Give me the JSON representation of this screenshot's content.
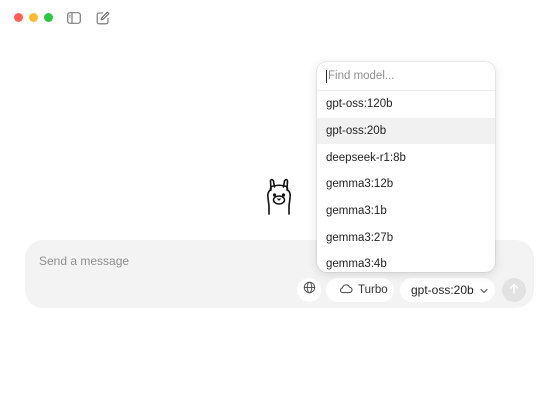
{
  "titlebar": {
    "traffic_lights": [
      {
        "name": "close",
        "color": "#ff5f57"
      },
      {
        "name": "minimize",
        "color": "#febc2e"
      },
      {
        "name": "zoom",
        "color": "#28c840"
      }
    ],
    "icons": [
      "sidebar-toggle-icon",
      "new-chat-icon"
    ]
  },
  "composer": {
    "placeholder": "Send a message",
    "turbo_label": "Turbo",
    "selected_model": "gpt-oss:20b"
  },
  "model_dropdown": {
    "search_placeholder": "Find model...",
    "models": [
      {
        "name": "gpt-oss:120b",
        "selected": false
      },
      {
        "name": "gpt-oss:20b",
        "selected": true
      },
      {
        "name": "deepseek-r1:8b",
        "selected": false
      },
      {
        "name": "gemma3:12b",
        "selected": false
      },
      {
        "name": "gemma3:1b",
        "selected": false
      },
      {
        "name": "gemma3:27b",
        "selected": false
      },
      {
        "name": "gemma3:4b",
        "selected": false
      }
    ]
  },
  "colors": {
    "composer_bg": "#f3f3f3",
    "selected_row": "#f1f1f1",
    "send_disabled": "#e2e2e2"
  }
}
